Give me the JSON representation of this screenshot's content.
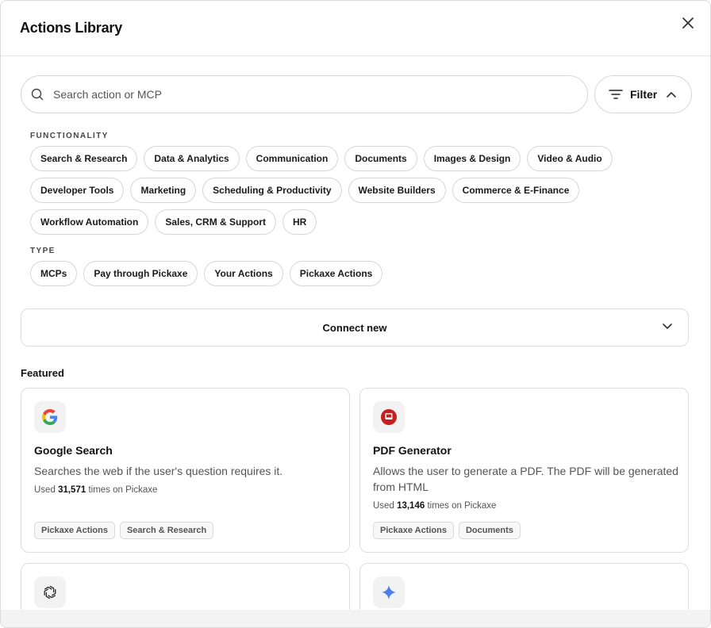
{
  "header": {
    "title": "Actions Library"
  },
  "search": {
    "placeholder": "Search action or MCP"
  },
  "filter": {
    "label": "Filter"
  },
  "functionality": {
    "label": "FUNCTIONALITY",
    "row1": [
      "Search & Research",
      "Data & Analytics",
      "Communication",
      "Documents",
      "Images & Design",
      "Video & Audio"
    ],
    "row2": [
      "Developer Tools",
      "Marketing",
      "Scheduling & Productivity",
      "Website Builders",
      "Commerce & E-Finance"
    ],
    "row3": [
      "Workflow Automation",
      "Sales, CRM & Support",
      "HR"
    ]
  },
  "type": {
    "label": "TYPE",
    "chips": [
      "MCPs",
      "Pay through Pickaxe",
      "Your Actions",
      "Pickaxe Actions"
    ]
  },
  "connect": {
    "label": "Connect new"
  },
  "featured": {
    "label": "Featured",
    "cards": [
      {
        "icon": "google-icon",
        "name": "Google Search",
        "description": "Searches the web if the user's question requires it.",
        "usage_prefix": "Used",
        "usage_count": "31,571",
        "usage_suffix": "times on Pickaxe",
        "tags": [
          "Pickaxe Actions",
          "Search & Research"
        ]
      },
      {
        "icon": "pdf-icon",
        "name": "PDF Generator",
        "description": "Allows the user to generate a PDF. The PDF will be generated from HTML",
        "usage_prefix": "Used",
        "usage_count": "13,146",
        "usage_suffix": "times on Pickaxe",
        "tags": [
          "Pickaxe Actions",
          "Documents"
        ]
      },
      {
        "icon": "openai-icon"
      },
      {
        "icon": "gemini-sparkle-icon"
      }
    ]
  },
  "colors": {
    "google_blue": "#4285F4",
    "google_red": "#EA4335",
    "google_yellow": "#FBBC05",
    "google_green": "#34A853",
    "pdf_red": "#c81e1e",
    "gemini_blue": "#4b7cf0"
  }
}
